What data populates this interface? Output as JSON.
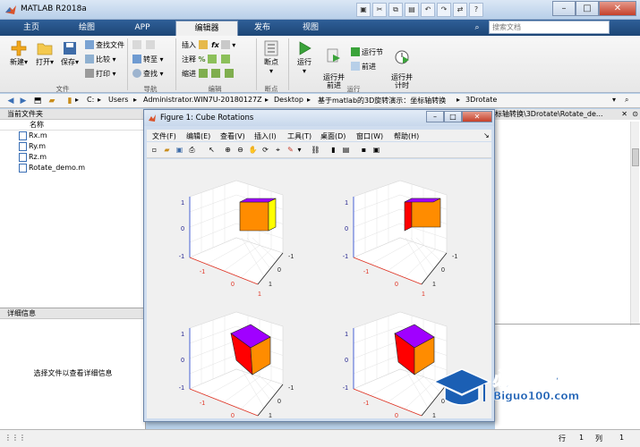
{
  "window": {
    "title": "MATLAB R2018a"
  },
  "search": {
    "placeholder": "搜索文档"
  },
  "tabs": [
    {
      "label": "主页"
    },
    {
      "label": "绘图"
    },
    {
      "label": "APP"
    },
    {
      "label": "编辑器"
    },
    {
      "label": "发布"
    },
    {
      "label": "视图"
    }
  ],
  "ribbon": {
    "new": "新建",
    "open": "打开",
    "save": "保存",
    "find_files": "查找文件",
    "compare": "比较",
    "print": "打印",
    "group_file": "文件",
    "goto": "转至",
    "find": "查找",
    "group_nav": "导航",
    "insert": "插入",
    "comment": "注释",
    "indent": "缩进",
    "group_edit": "编辑",
    "breakpoints": "断点",
    "group_breakpoints": "断点",
    "run": "运行",
    "run_advance": "运行并\n前进",
    "run_section": "运行节",
    "advance": "前进",
    "run_time": "运行并\n计时",
    "group_run": "运行"
  },
  "address": {
    "crumbs": [
      "C:",
      "Users",
      "Administrator.WIN7U-20180127Z",
      "Desktop",
      "基于matlab的3D旋转演示：坐标轴转换",
      "3Drotate"
    ]
  },
  "current_folder": {
    "title": "当前文件夹",
    "col_name": "名称",
    "files": [
      "Rx.m",
      "Ry.m",
      "Rz.m",
      "Rotate_demo.m"
    ]
  },
  "details": {
    "title": "详细信息",
    "hint": "选择文件以查看详细信息"
  },
  "editor": {
    "path_tail": "标轴转换\\3Drotate\\Rotate_de..."
  },
  "figure": {
    "title": "Figure 1: Cube Rotations",
    "menus": [
      "文件(F)",
      "编辑(E)",
      "查看(V)",
      "插入(I)",
      "工具(T)",
      "桌面(D)",
      "窗口(W)",
      "帮助(H)"
    ]
  },
  "axes_ticks": {
    "z": [
      "1",
      "0",
      "-1"
    ],
    "x": [
      "-1",
      "0",
      "1"
    ],
    "y": [
      "-1",
      "0",
      "1"
    ]
  },
  "status": {
    "row_label": "行",
    "row": "1",
    "col_label": "列",
    "col": "1"
  },
  "watermark": {
    "big": "必过源码",
    "small": "Biguo100.com"
  },
  "colors": {
    "cube_orange": "#ff8c00",
    "cube_yellow": "#ffff00",
    "cube_red": "#ff0000",
    "cube_purple": "#a000ff",
    "x_axis": "#e03020",
    "z_axis": "#2040d0"
  }
}
